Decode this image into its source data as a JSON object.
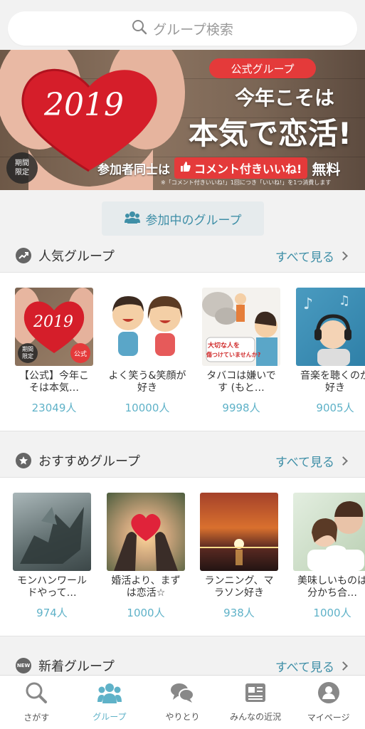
{
  "search": {
    "placeholder": "グループ検索"
  },
  "banner": {
    "badge_line1": "期間",
    "badge_line2": "限定",
    "heart_year": "2019",
    "pill": "公式グループ",
    "headline1": "今年こそは",
    "headline2": "本気で恋活!",
    "row_prefix": "参加者同士は",
    "row_highlight": "コメント付きいいね!",
    "row_suffix": "無料",
    "note": "※「コメント付きいいね!」1回につき「いいね!」を1つ消費します"
  },
  "joined_button": {
    "label": "参加中のグループ"
  },
  "sections": [
    {
      "title": "人気グループ",
      "more": "すべて見る",
      "items": [
        {
          "name": "【公式】今年こそは本気…",
          "count": "23049人",
          "badge1": "期間",
          "badge2": "限定",
          "badge_official": "公式",
          "year": "2019"
        },
        {
          "name": "よく笑う&笑顔が好き",
          "count": "10000人"
        },
        {
          "name": "タバコは嫌いです (もと…",
          "count": "9998人",
          "caption1": "大切な人を",
          "caption2": "傷つけていませんか?"
        },
        {
          "name": "音楽を聴くのが好き",
          "count": "9005人"
        }
      ]
    },
    {
      "title": "おすすめグループ",
      "more": "すべて見る",
      "items": [
        {
          "name": "モンハンワールドやって…",
          "count": "974人"
        },
        {
          "name": "婚活より、まずは恋活☆",
          "count": "1000人"
        },
        {
          "name": "ランニング、マラソン好き",
          "count": "938人"
        },
        {
          "name": "美味しいものは分かち合…",
          "count": "1000人"
        }
      ]
    },
    {
      "title": "新着グループ",
      "more": "すべて見る",
      "badge": "NEW"
    }
  ],
  "nav": [
    {
      "label": "さがす",
      "icon": "search-icon"
    },
    {
      "label": "グループ",
      "icon": "group-icon",
      "active": true
    },
    {
      "label": "やりとり",
      "icon": "chat-icon"
    },
    {
      "label": "みんなの近況",
      "icon": "news-icon"
    },
    {
      "label": "マイページ",
      "icon": "profile-icon"
    }
  ],
  "colors": {
    "accent": "#5fb2c8",
    "link": "#3f8fa7",
    "red": "#e43a3a"
  }
}
